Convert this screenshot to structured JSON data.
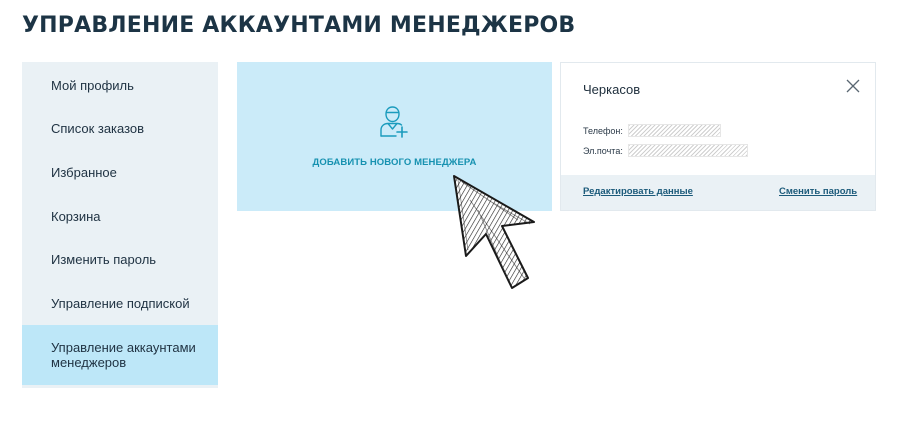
{
  "page": {
    "title": "УПРАВЛЕНИЕ АККАУНТАМИ МЕНЕДЖЕРОВ"
  },
  "sidebar": {
    "items": [
      {
        "label": "Мой профиль",
        "active": false
      },
      {
        "label": "Список заказов",
        "active": false
      },
      {
        "label": "Избранное",
        "active": false
      },
      {
        "label": "Корзина",
        "active": false
      },
      {
        "label": "Изменить пароль",
        "active": false
      },
      {
        "label": "Управление подпиской",
        "active": false
      },
      {
        "label": "Управление аккаунтами менеджеров",
        "active": true
      }
    ]
  },
  "add_manager": {
    "label": "ДОБАВИТЬ НОВОГО МЕНЕДЖЕРА",
    "icon": "add-user-icon"
  },
  "manager_card": {
    "name": "Черкасов",
    "phone_label": "Телефон:",
    "email_label": "Эл.почта:",
    "edit_link": "Редактировать данные",
    "change_password_link": "Сменить пароль",
    "close_icon": "close-icon"
  },
  "colors": {
    "accent": "#1691b0",
    "tile_bg": "#cbebf9",
    "sidebar_bg": "#eaf1f5",
    "sidebar_active_bg": "#bde7f8",
    "title": "#1c3445"
  }
}
